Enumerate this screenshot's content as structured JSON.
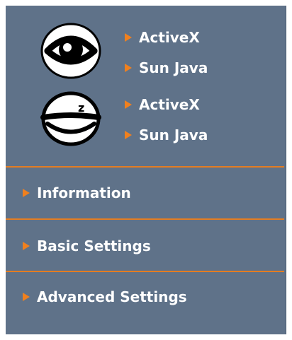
{
  "streams": {
    "live": {
      "icon": "eye-open-icon",
      "links": [
        {
          "label": "ActiveX"
        },
        {
          "label": "Sun Java"
        }
      ]
    },
    "sleep": {
      "icon": "eye-sleeping-icon",
      "badge": "z",
      "links": [
        {
          "label": "ActiveX"
        },
        {
          "label": "Sun Java"
        }
      ]
    }
  },
  "menu": [
    {
      "label": "Information"
    },
    {
      "label": "Basic Settings"
    },
    {
      "label": "Advanced Settings"
    }
  ],
  "colors": {
    "panel_bg": "#5f7289",
    "accent": "#f0801e",
    "divider": "#e37d22",
    "text": "#ffffff"
  }
}
